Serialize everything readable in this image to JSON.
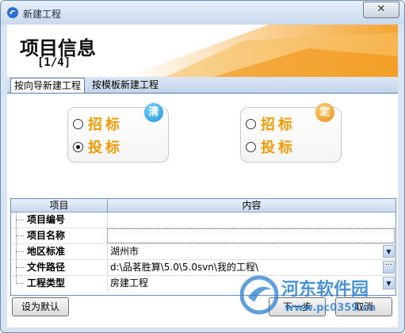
{
  "window": {
    "title": "新建工程",
    "close_glyph": "✕",
    "app_icon": "app-logo-icon"
  },
  "banner": {
    "title": "项目信息",
    "step": "[1/4]"
  },
  "tabs": [
    {
      "label": "按向导新建工程",
      "active": true
    },
    {
      "label": "按模板新建工程",
      "active": false
    }
  ],
  "options": {
    "left": {
      "badge": "清",
      "items": [
        {
          "label": "招标",
          "checked": false
        },
        {
          "label": "投标",
          "checked": true
        }
      ]
    },
    "right": {
      "badge": "定",
      "items": [
        {
          "label": "招标",
          "checked": false
        },
        {
          "label": "投标",
          "checked": false
        }
      ]
    }
  },
  "grid": {
    "headers": [
      "项目",
      "内容"
    ],
    "rows": [
      {
        "label": "项目编号",
        "value": ""
      },
      {
        "label": "项目名称",
        "value": ""
      },
      {
        "label": "地区标准",
        "value": "湖州市"
      },
      {
        "label": "文件路径",
        "value": "d:\\品茗胜算\\5.0\\5.0svn\\我的工程\\"
      },
      {
        "label": "工程类型",
        "value": "房建工程"
      }
    ]
  },
  "buttons": {
    "default": "设为默认",
    "next": "下一步",
    "cancel": "取消"
  },
  "watermark": {
    "brand": "河东软件园",
    "url": "www.pc0359.cn"
  },
  "colors": {
    "accent_orange": "#f29b00",
    "tab_border": "#5a7fb0"
  }
}
